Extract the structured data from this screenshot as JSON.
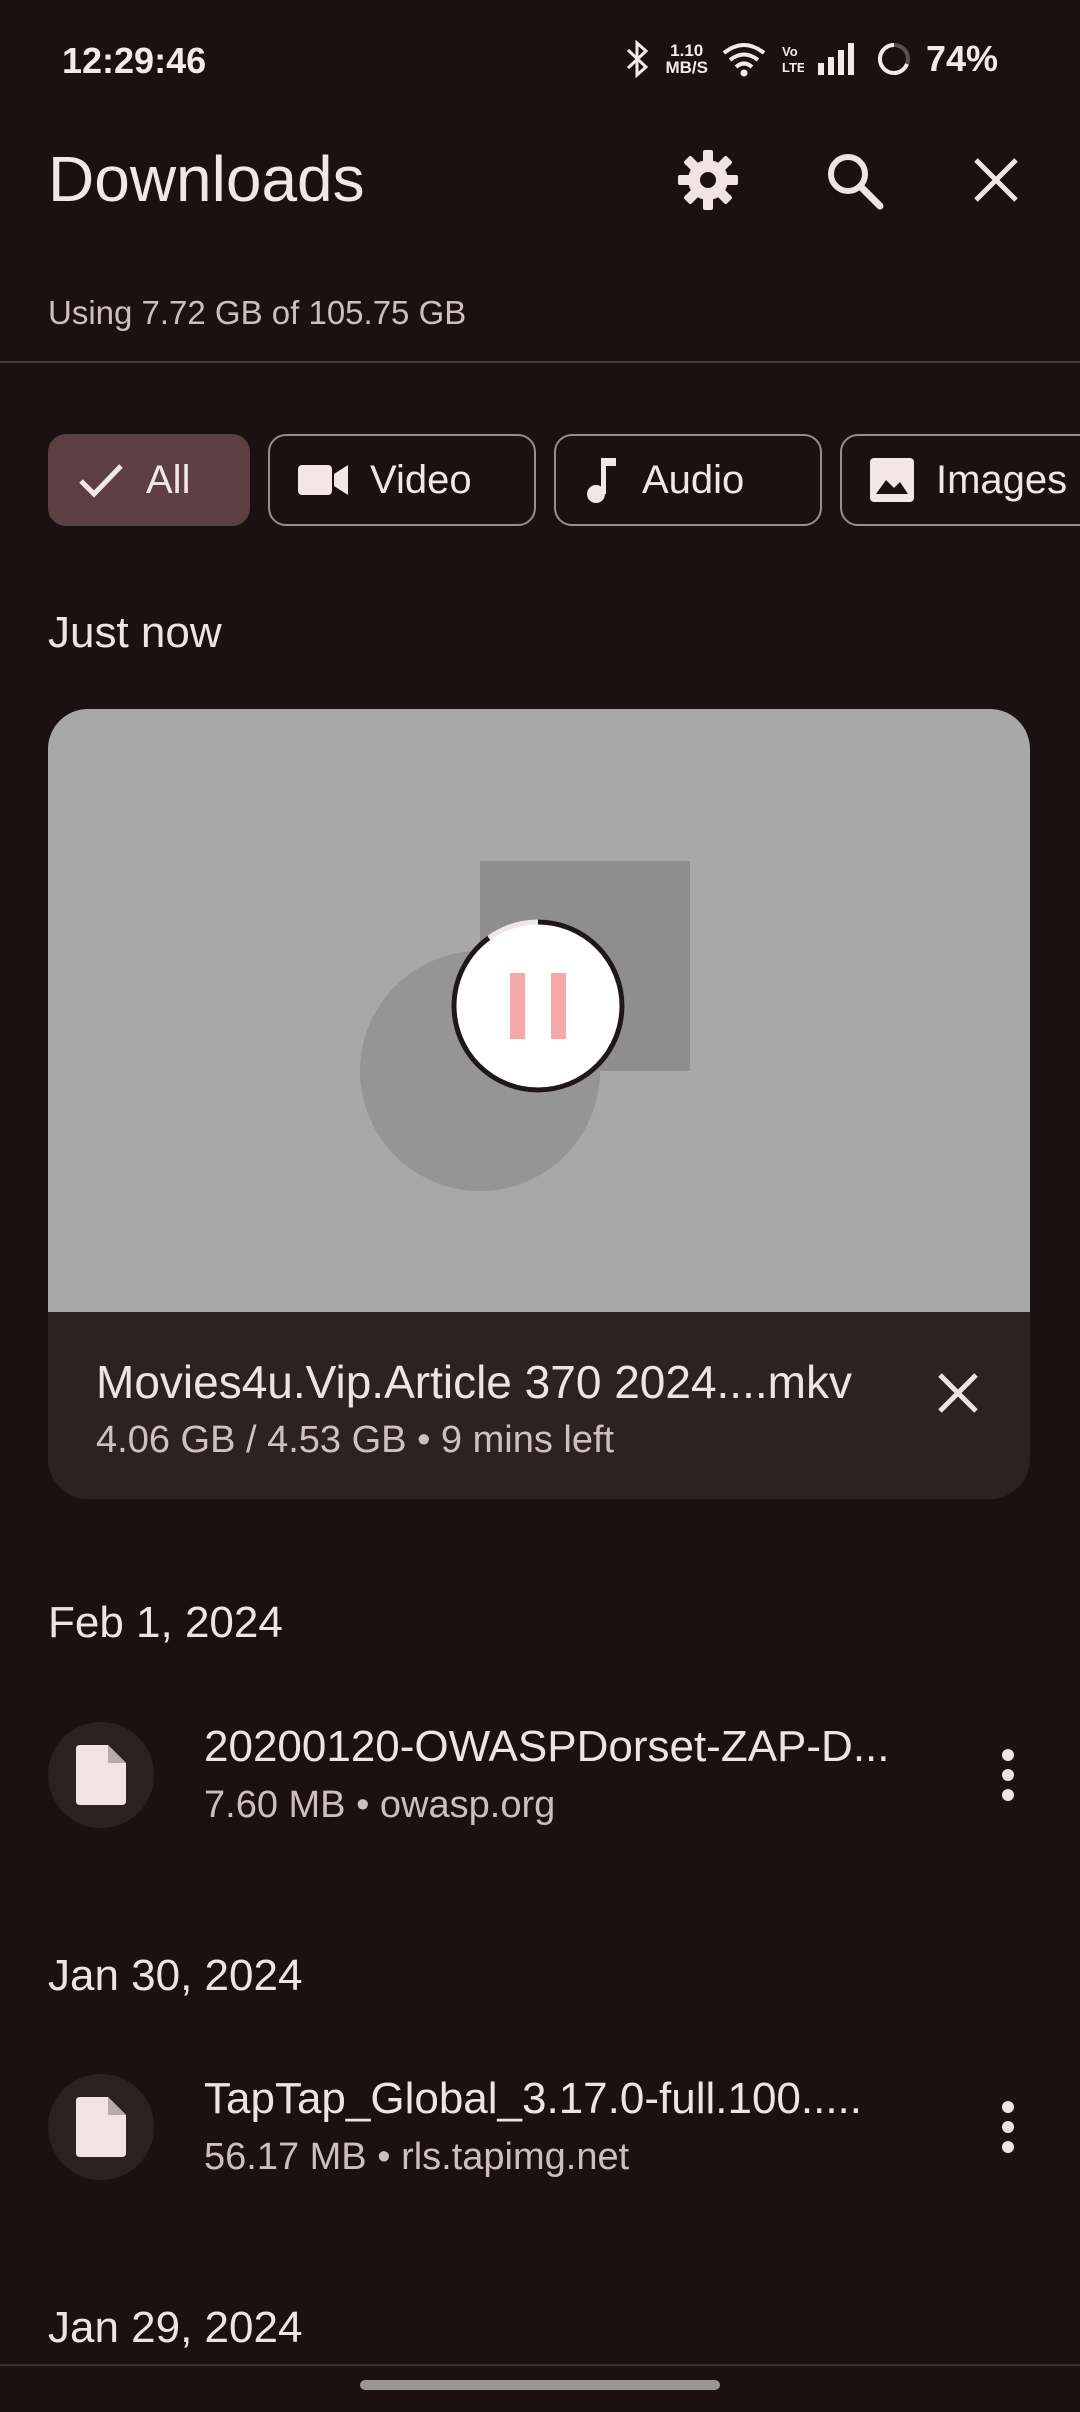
{
  "status_bar": {
    "time": "12:29:46",
    "speed_value": "1.10",
    "speed_unit": "MB/S",
    "battery": "74%"
  },
  "header": {
    "title": "Downloads",
    "storage": "Using 7.72 GB of 105.75 GB"
  },
  "filters": [
    {
      "label": "All",
      "icon": "check-icon",
      "selected": true
    },
    {
      "label": "Video",
      "icon": "video-icon",
      "selected": false
    },
    {
      "label": "Audio",
      "icon": "music-note-icon",
      "selected": false
    },
    {
      "label": "Images",
      "icon": "image-icon",
      "selected": false
    }
  ],
  "active_download": {
    "section": "Just now",
    "filename": "Movies4u.Vip.Article 370 2024....mkv",
    "progress_text": "4.06 GB / 4.53 GB • 9 mins left",
    "progress_fraction": 0.9
  },
  "groups": [
    {
      "date": "Feb 1, 2024",
      "items": [
        {
          "name": "20200120-OWASPDorset-ZAP-D...",
          "meta": "7.60 MB • owasp.org"
        }
      ]
    },
    {
      "date": "Jan 30, 2024",
      "items": [
        {
          "name": "TapTap_Global_3.17.0-full.100.....",
          "meta": "56.17 MB • rls.tapimg.net"
        }
      ]
    },
    {
      "date": "Jan 29, 2024",
      "items": []
    }
  ],
  "colors": {
    "background": "#1b1112",
    "chip_selected": "#5c3f40",
    "pause_accent": "#f4a8a8"
  }
}
